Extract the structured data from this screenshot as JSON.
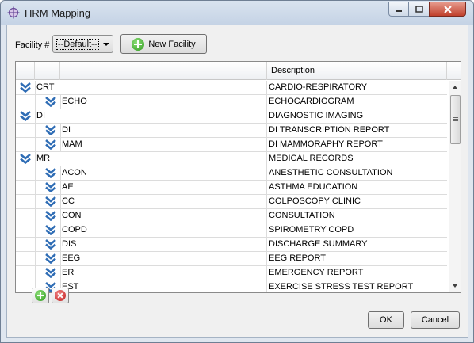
{
  "window": {
    "title": "HRM Mapping",
    "icon": "crosshair-globe-icon"
  },
  "toolbar": {
    "facility_label": "Facility #",
    "facility_value": "--Default--",
    "new_facility_label": "New Facility"
  },
  "table": {
    "headers": [
      "",
      "",
      "",
      "Description"
    ],
    "rows": [
      {
        "level": 0,
        "code": "CRT",
        "description": "CARDIO-RESPIRATORY"
      },
      {
        "level": 1,
        "code": "ECHO",
        "description": "ECHOCARDIOGRAM"
      },
      {
        "level": 0,
        "code": "DI",
        "description": "DIAGNOSTIC IMAGING"
      },
      {
        "level": 1,
        "code": "DI",
        "description": "DI TRANSCRIPTION REPORT"
      },
      {
        "level": 1,
        "code": "MAM",
        "description": "DI MAMMORAPHY REPORT"
      },
      {
        "level": 0,
        "code": "MR",
        "description": "MEDICAL RECORDS"
      },
      {
        "level": 1,
        "code": "ACON",
        "description": "ANESTHETIC CONSULTATION"
      },
      {
        "level": 1,
        "code": "AE",
        "description": "ASTHMA EDUCATION"
      },
      {
        "level": 1,
        "code": "CC",
        "description": "COLPOSCOPY CLINIC"
      },
      {
        "level": 1,
        "code": "CON",
        "description": "CONSULTATION"
      },
      {
        "level": 1,
        "code": "COPD",
        "description": "SPIROMETRY COPD"
      },
      {
        "level": 1,
        "code": "DIS",
        "description": "DISCHARGE SUMMARY"
      },
      {
        "level": 1,
        "code": "EEG",
        "description": "EEG REPORT"
      },
      {
        "level": 1,
        "code": "ER",
        "description": "EMERGENCY REPORT"
      },
      {
        "level": 1,
        "code": "EST",
        "description": "EXERCISE STRESS TEST REPORT"
      }
    ]
  },
  "buttons": {
    "ok": "OK",
    "cancel": "Cancel"
  },
  "colors": {
    "chevron": "#2f6db5",
    "titlebar": "#c5d3e5"
  }
}
